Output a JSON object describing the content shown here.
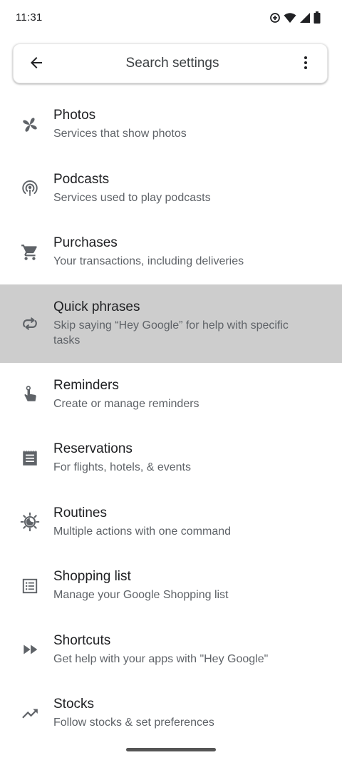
{
  "status_bar": {
    "time": "11:31"
  },
  "search": {
    "placeholder": "Search settings"
  },
  "colors": {
    "icon": "#5f6368",
    "highlight": "#cdcdcd",
    "title": "#202124",
    "subtitle": "#5f6368"
  },
  "items": [
    {
      "icon": "pinwheel-icon",
      "title": "Photos",
      "subtitle": "Services that show photos"
    },
    {
      "icon": "podcast-icon",
      "title": "Podcasts",
      "subtitle": "Services used to play podcasts"
    },
    {
      "icon": "shopping-cart-icon",
      "title": "Purchases",
      "subtitle": "Your transactions, including deliveries"
    },
    {
      "icon": "quick-phrases-icon",
      "title": "Quick phrases",
      "subtitle": "Skip saying “Hey Google” for help with specific tasks",
      "selected": true
    },
    {
      "icon": "reminder-icon",
      "title": "Reminders",
      "subtitle": "Create or manage reminders"
    },
    {
      "icon": "receipt-icon",
      "title": "Reservations",
      "subtitle": "For flights, hotels, & events"
    },
    {
      "icon": "routines-icon",
      "title": "Routines",
      "subtitle": "Multiple actions with one command"
    },
    {
      "icon": "list-icon",
      "title": "Shopping list",
      "subtitle": "Manage your Google Shopping list"
    },
    {
      "icon": "fast-forward-icon",
      "title": "Shortcuts",
      "subtitle": "Get help with your apps with \"Hey Google\""
    },
    {
      "icon": "trending-up-icon",
      "title": "Stocks",
      "subtitle": "Follow stocks & set preferences"
    }
  ]
}
